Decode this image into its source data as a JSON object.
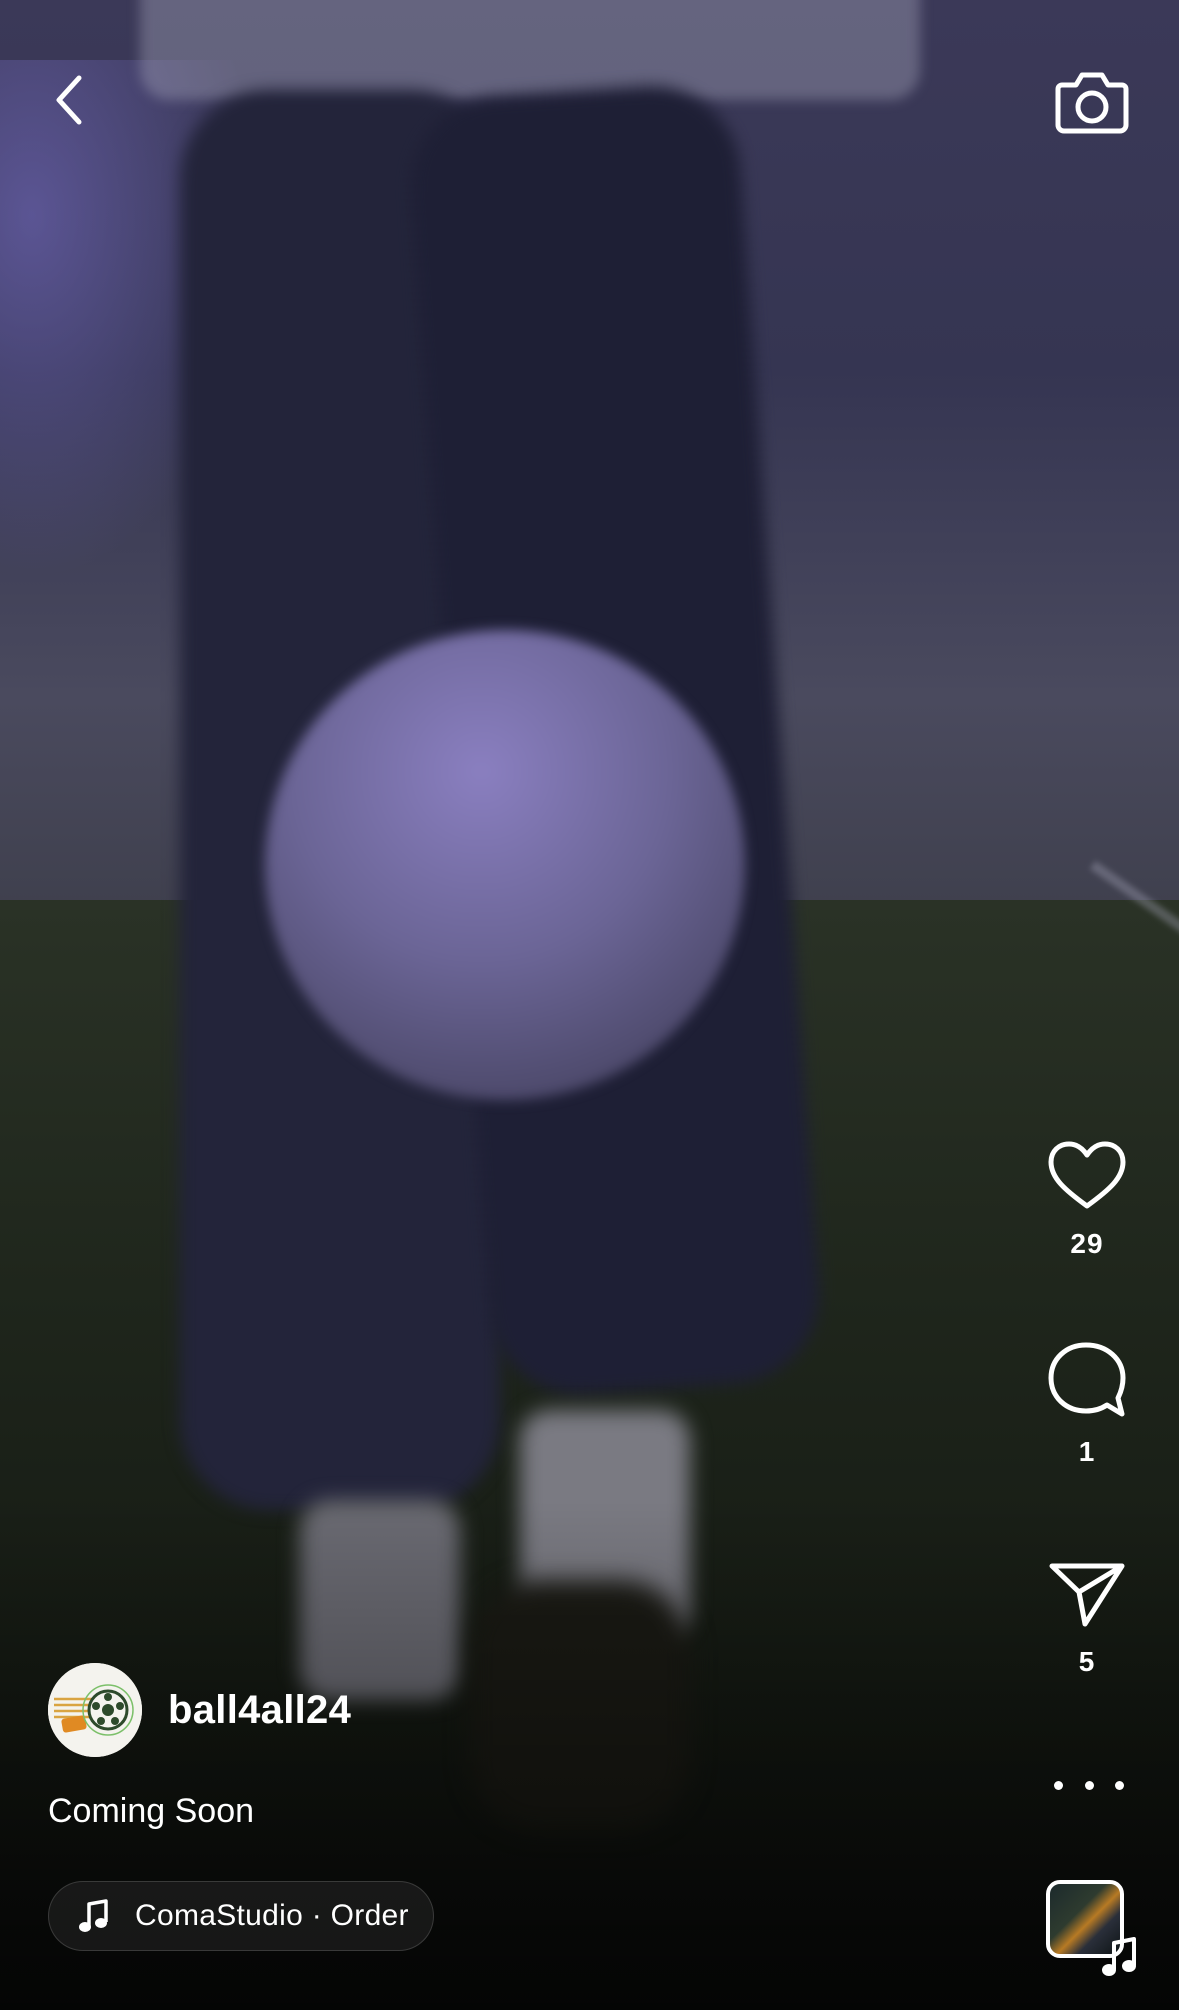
{
  "post": {
    "username": "ball4all24",
    "caption": "Coming Soon",
    "audio": "ComaStudio · Order"
  },
  "actions": {
    "likes": "29",
    "comments": "1",
    "shares": "5"
  },
  "icons": {
    "back": "chevron-left-icon",
    "camera": "camera-icon",
    "like": "heart-icon",
    "comment": "comment-bubble-icon",
    "share": "paper-plane-icon",
    "more": "more-horizontal-icon",
    "music": "music-note-icon"
  },
  "colors": {
    "text": "#ffffff",
    "pill_bg": "#1e1e1e"
  }
}
